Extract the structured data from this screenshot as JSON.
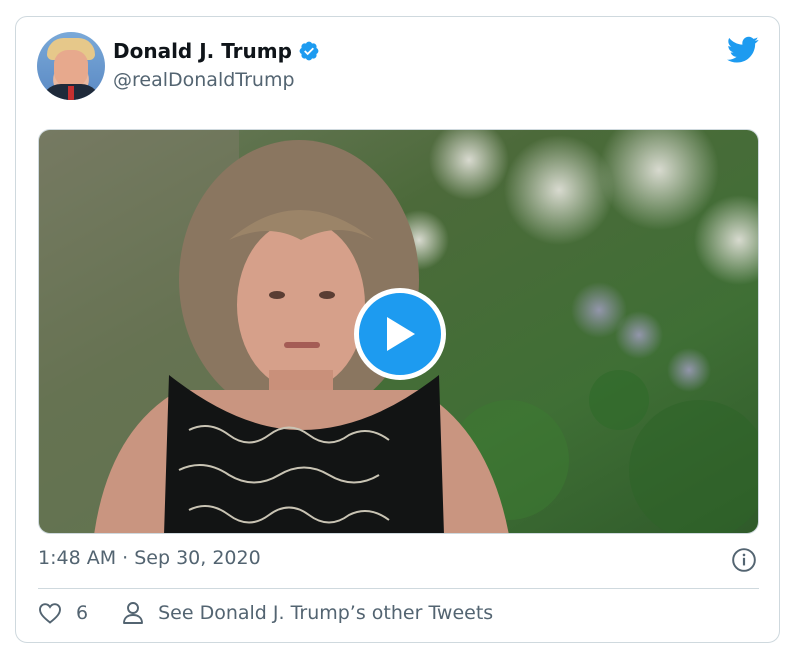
{
  "tweet": {
    "author": {
      "display_name": "Donald J. Trump",
      "handle": "@realDonaldTrump",
      "verified": true
    },
    "media": {
      "type": "video",
      "play_icon": "play-icon"
    },
    "timestamp": "1:48 AM · Sep 30, 2020",
    "actions": {
      "like_count": "6",
      "other_tweets_label": "See Donald J. Trump’s other Tweets"
    }
  },
  "icons": {
    "brand": "twitter-bird-icon",
    "verified": "verified-badge-icon",
    "info": "info-icon",
    "like": "heart-icon",
    "profile": "person-icon"
  },
  "colors": {
    "accent": "#1d9bf0",
    "text_primary": "#0f1419",
    "text_secondary": "#536471",
    "border": "#cfd9de"
  }
}
